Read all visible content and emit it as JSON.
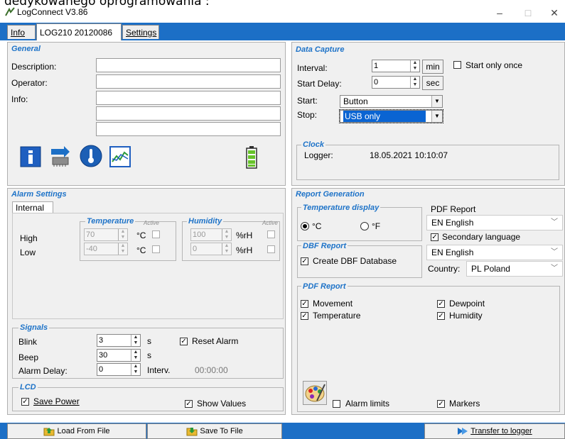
{
  "top_cut_text": "dedykowanego oprogramowania :",
  "window": {
    "title": "LogConnect V3.86",
    "minimize": "–",
    "maximize": "□",
    "close": "✕"
  },
  "tabs": [
    {
      "label": "Info"
    },
    {
      "label": "LOG210 20120086"
    },
    {
      "label": "Settings"
    }
  ],
  "general": {
    "title": "General",
    "description_label": "Description:",
    "operator_label": "Operator:",
    "info_label": "Info:",
    "description_value": "",
    "operator_value": "",
    "info_lines": [
      "",
      "",
      ""
    ]
  },
  "icons": [
    "info-icon",
    "chip-transfer-icon",
    "thermometer-icon",
    "graph-icon",
    "battery-icon"
  ],
  "data_capture": {
    "title": "Data Capture",
    "interval_label": "Interval:",
    "interval_value": "1",
    "interval_unit": "min",
    "start_only_once_label": "Start only once",
    "start_delay_label": "Start Delay:",
    "start_delay_value": "0",
    "start_delay_unit": "sec",
    "start_label": "Start:",
    "start_value": "Button",
    "stop_label": "Stop:",
    "stop_value": "USB only"
  },
  "clock": {
    "title": "Clock",
    "logger_label": "Logger:",
    "logger_value": "18.05.2021 10:10:07"
  },
  "alarm": {
    "title": "Alarm Settings",
    "tab": "Internal",
    "temperature_title": "Temperature",
    "humidity_title": "Humidity",
    "active_label": "Active",
    "high_label": "High",
    "low_label": "Low",
    "temp_high": "70",
    "temp_low": "-40",
    "temp_unit": "°C",
    "hum_high": "100",
    "hum_low": "0",
    "hum_unit": "%rH"
  },
  "signals": {
    "title": "Signals",
    "blink_label": "Blink",
    "blink_value": "3",
    "blink_unit": "s",
    "reset_alarm_label": "Reset Alarm",
    "beep_label": "Beep",
    "beep_value": "30",
    "beep_unit": "s",
    "alarm_delay_label": "Alarm Delay:",
    "alarm_delay_value": "0",
    "alarm_delay_unit": "Interv.",
    "alarm_delay_time": "00:00:00"
  },
  "lcd": {
    "title": "LCD",
    "save_power_label": "Save Power",
    "show_values_label": "Show Values"
  },
  "report": {
    "title": "Report Generation",
    "temp_display_title": "Temperature display",
    "celsius_label": "°C",
    "fahrenheit_label": "°F",
    "dbf_title": "DBF Report",
    "create_dbf_label": "Create DBF Database",
    "pdf_report_label": "PDF Report",
    "pdf_language": "EN English",
    "secondary_language_label": "Secondary language",
    "secondary_language": "EN English",
    "country_label": "Country:",
    "country_value": "PL Poland",
    "pdf_title": "PDF Report",
    "movement_label": "Movement",
    "dewpoint_label": "Dewpoint",
    "temperature_label": "Temperature",
    "humidity_label": "Humidity",
    "alarm_limits_label": "Alarm limits",
    "markers_label": "Markers"
  },
  "bottom": {
    "load_label": "Load From File",
    "save_label": "Save To File",
    "transfer_label": "Transfer to logger"
  },
  "colors": {
    "accent": "#1c6fc6",
    "title_blue": "#1e73c8",
    "selection": "#0a64d2"
  }
}
